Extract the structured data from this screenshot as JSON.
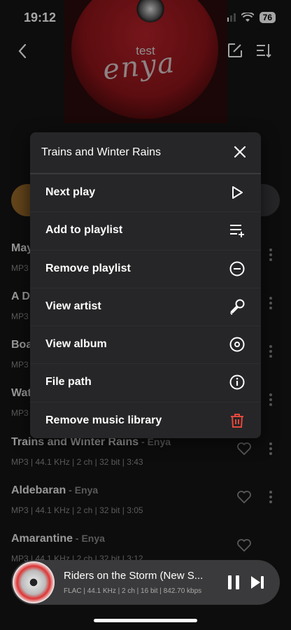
{
  "status": {
    "time": "19:12",
    "battery": "76"
  },
  "header": {
    "title": "test"
  },
  "songs": [
    {
      "title": "May",
      "artist": "",
      "meta": "MP3"
    },
    {
      "title": "A D",
      "artist": "",
      "meta": "MP3"
    },
    {
      "title": "Boa",
      "artist": "",
      "meta": "MP3"
    },
    {
      "title": "Wat",
      "artist": "",
      "meta": "MP3"
    },
    {
      "title": "Trains and Winter Rains",
      "artist": " - Enya",
      "meta": "MP3 | 44.1 KHz | 2 ch | 32 bit | 3:43"
    },
    {
      "title": "Aldebaran",
      "artist": " - Enya",
      "meta": "MP3 | 44.1 KHz | 2 ch | 32 bit | 3:05"
    },
    {
      "title": "Amarantine",
      "artist": " - Enya",
      "meta": "MP3 | 44.1 KHz | 2 ch | 32 bit | 3:12"
    }
  ],
  "menu": {
    "title": "Trains and Winter Rains",
    "items": [
      {
        "label": "Next play",
        "icon": "play-outline-icon"
      },
      {
        "label": "Add to playlist",
        "icon": "add-to-playlist-icon"
      },
      {
        "label": "Remove playlist",
        "icon": "minus-circle-icon"
      },
      {
        "label": "View artist",
        "icon": "microphone-icon"
      },
      {
        "label": "View album",
        "icon": "disc-icon"
      },
      {
        "label": "File path",
        "icon": "info-icon"
      },
      {
        "label": "Remove music library",
        "icon": "trash-icon"
      }
    ],
    "danger_color": "#e5483b"
  },
  "player": {
    "title": "Riders on the Storm (New S...",
    "meta": "FLAC | 44.1 KHz | 2 ch | 16 bit | 842.70 kbps"
  }
}
